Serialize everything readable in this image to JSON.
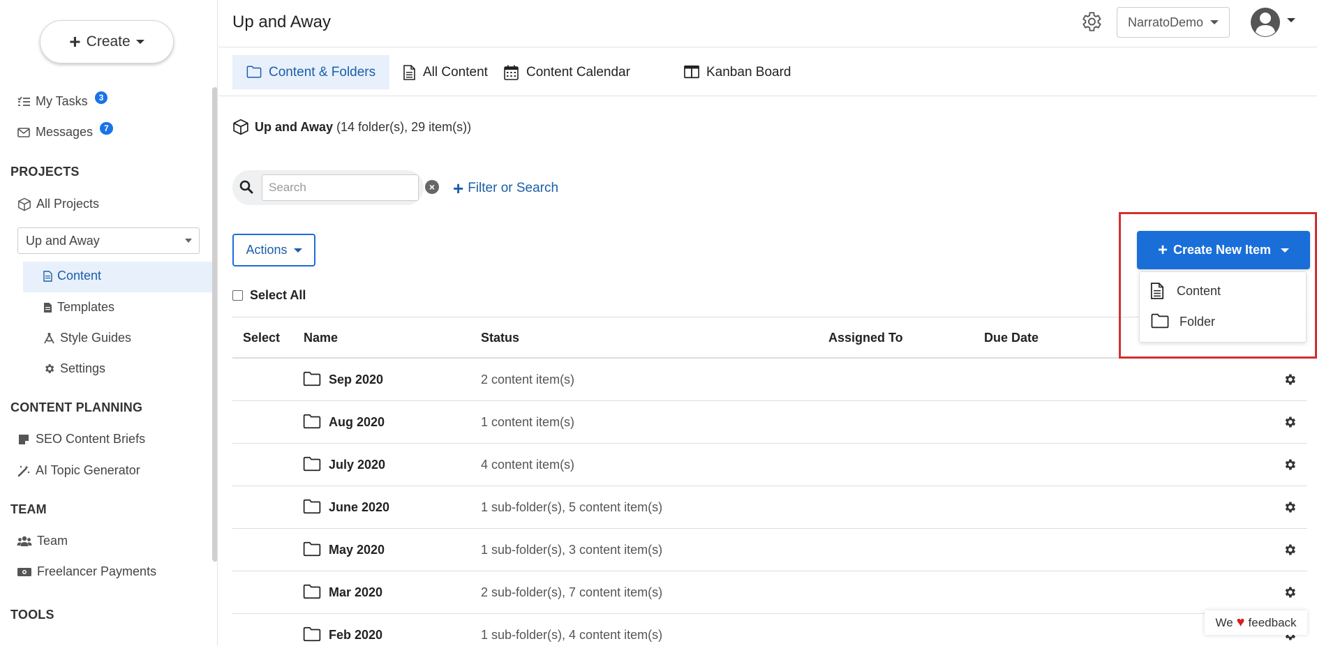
{
  "sidebar": {
    "create_label": "Create",
    "my_tasks": {
      "label": "My Tasks",
      "count": "3"
    },
    "messages": {
      "label": "Messages",
      "count": "7"
    },
    "projects_title": "PROJECTS",
    "all_projects": "All Projects",
    "project_select": "Up and Away",
    "project_items": {
      "content": "Content",
      "templates": "Templates",
      "style_guides": "Style Guides",
      "settings": "Settings"
    },
    "planning_title": "CONTENT PLANNING",
    "seo_briefs": "SEO Content Briefs",
    "ai_topic": "AI Topic Generator",
    "team_title": "TEAM",
    "team": "Team",
    "freelancer_payments": "Freelancer Payments",
    "tools_title": "TOOLS"
  },
  "header": {
    "title": "Up and Away",
    "account": "NarratoDemo"
  },
  "tabs": {
    "content_folders": "Content & Folders",
    "all_content": "All Content",
    "content_calendar": "Content Calendar",
    "kanban_board": "Kanban Board"
  },
  "summary": {
    "project_name": "Up and Away",
    "counts": "(14 folder(s), 29 item(s))"
  },
  "search": {
    "placeholder": "Search",
    "filter_label": "Filter or Search"
  },
  "actions_label": "Actions",
  "select_all_label": "Select All",
  "create_new": {
    "label": "Create New Item",
    "options": {
      "content": "Content",
      "folder": "Folder"
    }
  },
  "table": {
    "headers": {
      "select": "Select",
      "name": "Name",
      "status": "Status",
      "assigned_to": "Assigned To",
      "due_date": "Due Date"
    },
    "rows": [
      {
        "name": "Sep 2020",
        "status": "2 content item(s)"
      },
      {
        "name": "Aug 2020",
        "status": "1 content item(s)"
      },
      {
        "name": "July 2020",
        "status": "4 content item(s)"
      },
      {
        "name": "June 2020",
        "status": "1 sub-folder(s), 5 content item(s)"
      },
      {
        "name": "May 2020",
        "status": "1 sub-folder(s), 3 content item(s)"
      },
      {
        "name": "Mar 2020",
        "status": "2 sub-folder(s), 7 content item(s)"
      },
      {
        "name": "Feb 2020",
        "status": "1 sub-folder(s), 4 content item(s)"
      }
    ]
  },
  "feedback": {
    "before": "We",
    "after": "feedback"
  },
  "colors": {
    "primary": "#1a6ed8",
    "link": "#1a5ea8",
    "badge": "#1a73e8",
    "active_bg": "#e8f0fc",
    "highlight": "#d32f2f",
    "heart": "#d62020"
  }
}
